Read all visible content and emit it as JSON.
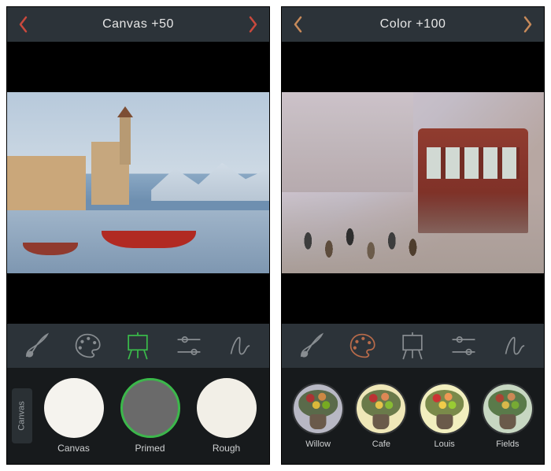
{
  "left": {
    "header": {
      "title": "Canvas +50",
      "back_color": "#c9493d",
      "next_color": "#c9493d"
    },
    "toolbar": {
      "items": [
        "brush",
        "palette",
        "canvas",
        "sliders",
        "signature"
      ],
      "active_index": 2
    },
    "strip": {
      "tab_label": "Canvas",
      "options": [
        {
          "label": "Canvas"
        },
        {
          "label": "Primed"
        },
        {
          "label": "Rough"
        }
      ],
      "selected_index": 1
    }
  },
  "right": {
    "header": {
      "title": "Color +100",
      "back_color": "#c78a5a",
      "next_color": "#c78a5a"
    },
    "toolbar": {
      "items": [
        "brush",
        "palette",
        "canvas",
        "sliders",
        "signature"
      ],
      "active_index": 1
    },
    "strip": {
      "options": [
        {
          "label": "Willow"
        },
        {
          "label": "Cafe"
        },
        {
          "label": "Louis"
        },
        {
          "label": "Fields"
        }
      ]
    }
  }
}
